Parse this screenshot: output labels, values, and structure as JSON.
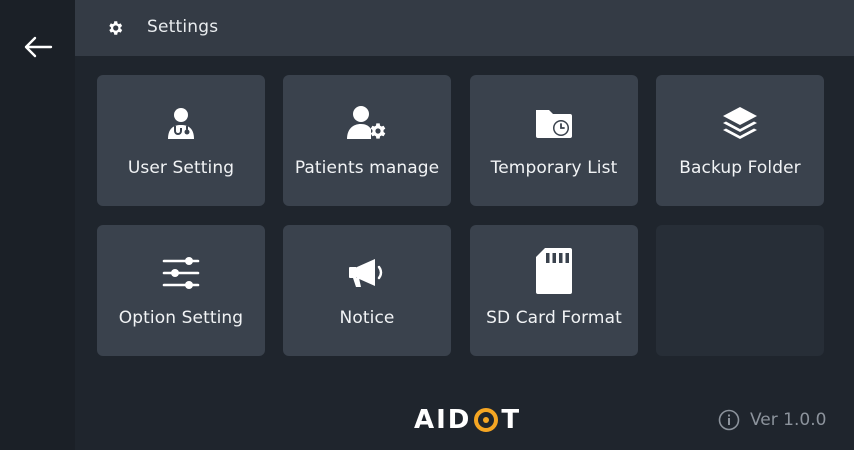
{
  "header": {
    "title": "Settings",
    "icon": "gear-icon"
  },
  "nav": {
    "back_icon": "arrow-left-icon"
  },
  "tiles": [
    {
      "label": "User Setting",
      "icon": "doctor-user-icon"
    },
    {
      "label": "Patients manage",
      "icon": "patient-gear-icon"
    },
    {
      "label": "Temporary List",
      "icon": "folder-clock-icon"
    },
    {
      "label": "Backup Folder",
      "icon": "layers-icon"
    },
    {
      "label": "Option Setting",
      "icon": "sliders-icon"
    },
    {
      "label": "Notice",
      "icon": "megaphone-icon"
    },
    {
      "label": "SD Card Format",
      "icon": "sd-card-icon"
    }
  ],
  "footer": {
    "brand": {
      "prefix": "AID",
      "suffix": "T",
      "accent_color": "#f5a623"
    },
    "version": "Ver 1.0.0",
    "info_icon": "info-icon"
  },
  "colors": {
    "background": "#1f252d",
    "header": "#343b45",
    "tile": "#3a424d",
    "tile_empty": "#272e37",
    "accent": "#f5a623"
  }
}
